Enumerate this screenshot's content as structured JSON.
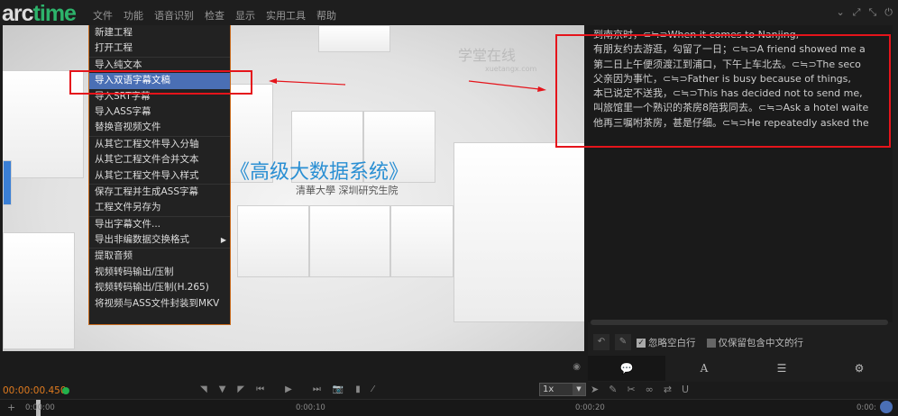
{
  "app": {
    "logo": "arctime"
  },
  "menubar": [
    "文件",
    "功能",
    "语音识别",
    "检查",
    "显示",
    "实用工具",
    "帮助"
  ],
  "window_controls": [
    "chevron-down-icon",
    "restore-icon",
    "maximize-icon",
    "power-icon"
  ],
  "video": {
    "title": "《高级大数据系统》",
    "subtitle": "清華大學 深圳研究生院",
    "watermark": "学堂在线",
    "watermark_url": "xuetangx.com"
  },
  "file_menu": {
    "groups": [
      [
        "新建工程",
        "打开工程"
      ],
      [
        "导入纯文本",
        "导入双语字幕文稿",
        "导入SRT字幕",
        "导入ASS字幕",
        "替换音视频文件"
      ],
      [
        "从其它工程文件导入分轴",
        "从其它工程文件合并文本",
        "从其它工程文件导入样式"
      ],
      [
        "保存工程并生成ASS字幕",
        "工程文件另存为"
      ],
      [
        "导出字幕文件...",
        "导出非编数据交换格式"
      ],
      [
        "提取音频",
        "视频转码输出/压制",
        "视频转码输出/压制(H.265)",
        "将视频与ASS文件封装到MKV"
      ]
    ],
    "selected": "导入双语字幕文稿",
    "submenu_item": "导出非编数据交换格式"
  },
  "text_lines": [
    "到南京时，⊂≒⊃When it comes to Nanjing,",
    "有朋友约去游逛，勾留了一日；⊂≒⊃A friend showed me a",
    "第二日上午便须渡江到浦口，下午上车北去。⊂≒⊃The seco",
    "父亲因为事忙，⊂≒⊃Father is busy because of things,",
    "本已说定不送我，⊂≒⊃This has decided not to send me,",
    "叫旅馆里一个熟识的茶房8陪我同去。⊂≒⊃Ask a hotel waite",
    "他再三嘱咐茶房，甚是仔细。⊂≒⊃He repeatedly asked the"
  ],
  "options": {
    "ignore_blank": "忽略空白行",
    "ignore_blank_checked": true,
    "keep_chinese": "仅保留包含中文的行",
    "keep_chinese_checked": false
  },
  "tabs": [
    "chat-icon",
    "text-style-icon",
    "list-icon",
    "gear-icon"
  ],
  "player": {
    "time": "00:00:00.450",
    "speed": "1x"
  },
  "timeline": {
    "ticks": [
      "0:00:00",
      "0:00:10",
      "0:00:20",
      "0:00:"
    ]
  },
  "colors": {
    "accent": "#2db36b",
    "time": "#e07b1f",
    "menu_border": "#c86a1c",
    "selection": "#4a6fb5",
    "annotation": "#e5141b"
  }
}
